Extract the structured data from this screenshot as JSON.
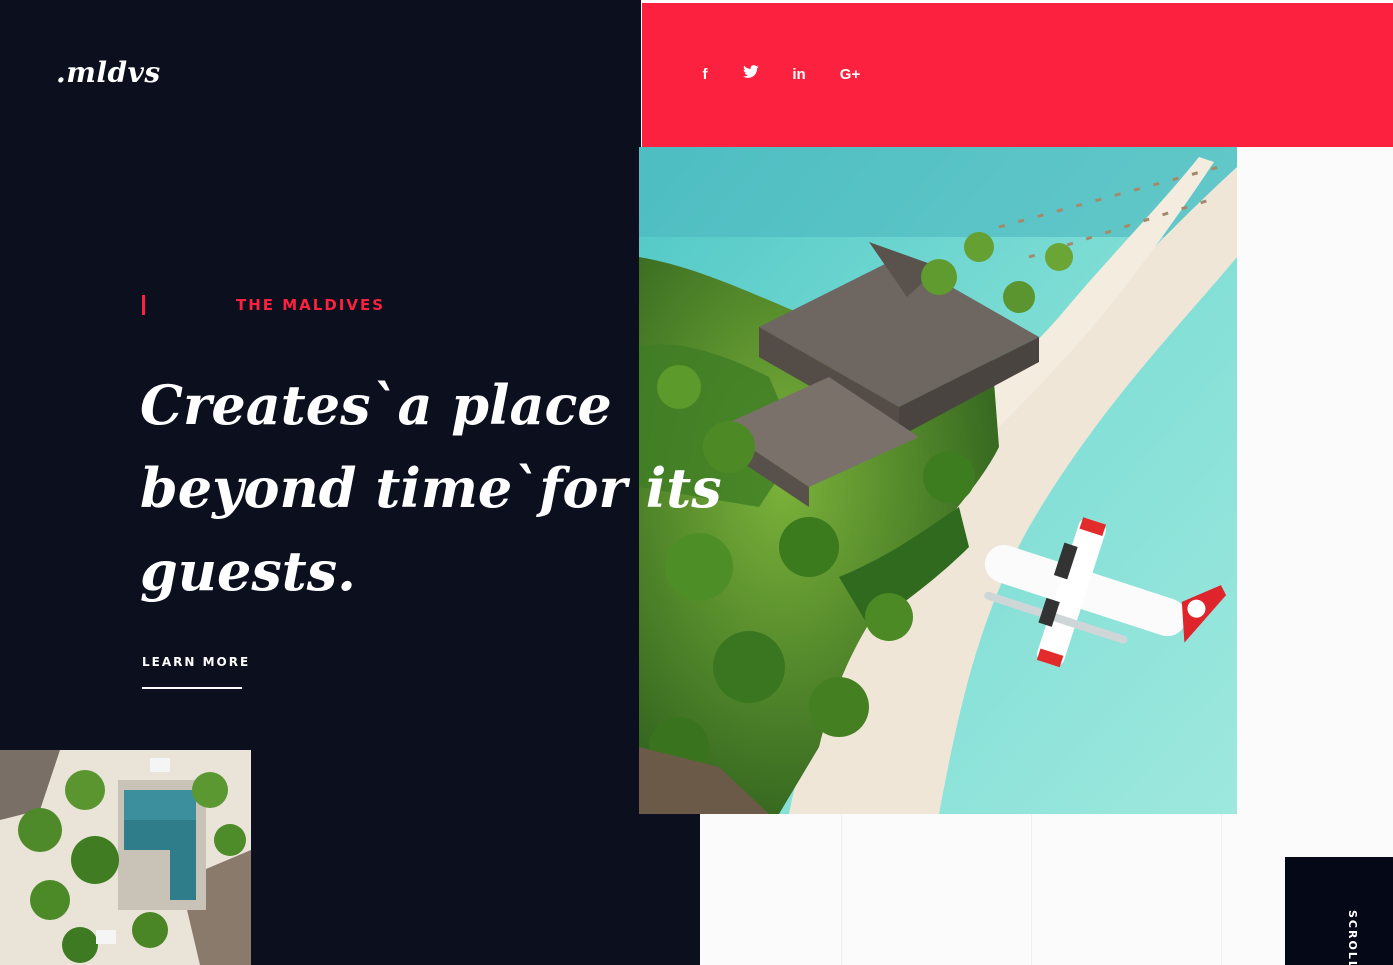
{
  "brand": {
    "logo": ".mldvs"
  },
  "social": [
    {
      "name": "facebook-icon",
      "glyph": "f"
    },
    {
      "name": "twitter-icon",
      "glyph": "t"
    },
    {
      "name": "linkedin-icon",
      "glyph": "in"
    },
    {
      "name": "google-plus-icon",
      "glyph": "G+"
    }
  ],
  "hero": {
    "eyebrow": "THE MALDIVES",
    "headline_lines": [
      "Creates`a place",
      "beyond time`for its",
      "guests."
    ],
    "cta": "LEARN MORE"
  },
  "scroll": {
    "label": "SCROLL"
  },
  "colors": {
    "accent": "#fc223f",
    "dark": "#0b0f1e",
    "white": "#ffffff"
  }
}
